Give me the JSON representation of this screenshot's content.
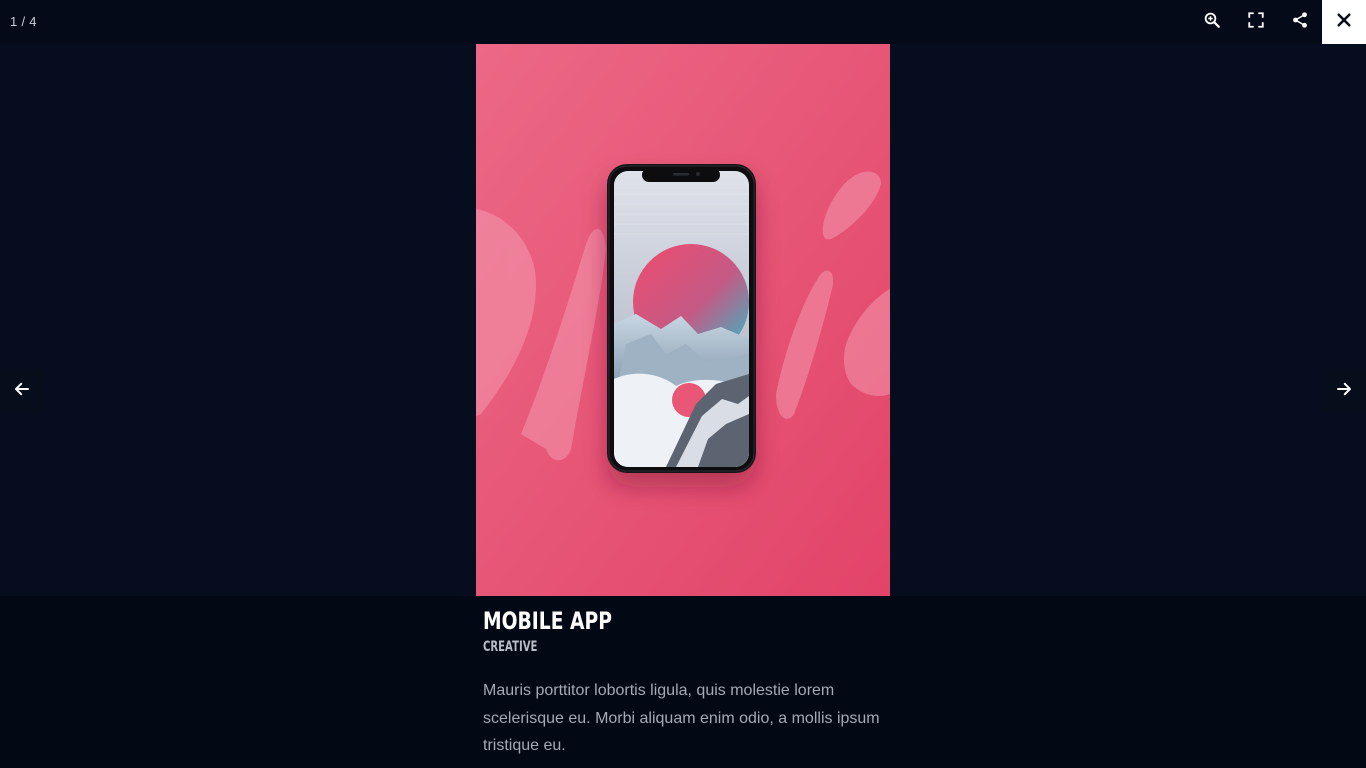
{
  "viewer": {
    "counter": "1 / 4"
  },
  "toolbar": {
    "zoom_icon": "zoom-in-icon",
    "fullscreen_icon": "fullscreen-icon",
    "share_icon": "share-icon",
    "close_icon": "close-icon"
  },
  "navigation": {
    "prev_icon": "arrow-left-icon",
    "next_icon": "arrow-right-icon"
  },
  "slide": {
    "image_description_icon": "phone-mockup-image",
    "background_color": "#e85578"
  },
  "caption": {
    "title": "MOBILE APP",
    "category": "CREATIVE",
    "description": "Mauris porttitor lobortis ligula, quis molestie lorem scelerisque eu. Morbi aliquam enim odio, a mollis ipsum tristique eu."
  },
  "colors": {
    "background": "#050d1e",
    "toolbar": "#040a17",
    "caption_bar": "#030815",
    "accent_pink": "#e85578"
  }
}
